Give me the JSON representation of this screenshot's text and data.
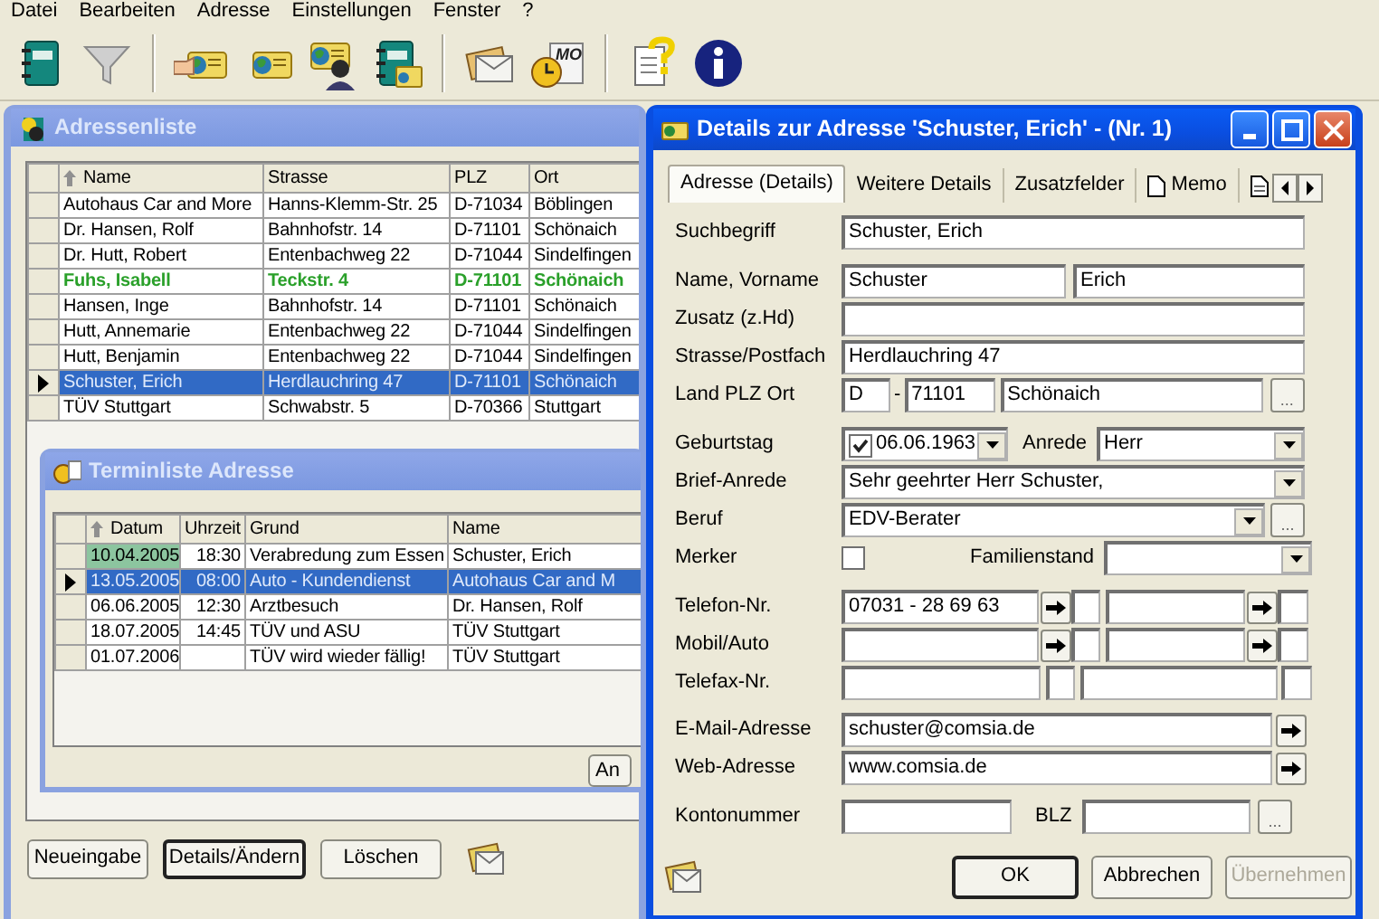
{
  "menu": [
    "Datei",
    "Bearbeiten",
    "Adresse",
    "Einstellungen",
    "Fenster",
    "?"
  ],
  "toolbar": [
    {
      "kind": "notebook"
    },
    {
      "kind": "funnel"
    },
    {
      "kind": "separator"
    },
    {
      "kind": "card-hand"
    },
    {
      "kind": "card-globe"
    },
    {
      "kind": "card-person"
    },
    {
      "kind": "notebook-card"
    },
    {
      "kind": "separator"
    },
    {
      "kind": "letters"
    },
    {
      "kind": "clock-memo",
      "caption": "MO"
    },
    {
      "kind": "separator"
    },
    {
      "kind": "help"
    },
    {
      "kind": "info"
    }
  ],
  "address_window": {
    "title": "Adressenliste",
    "columns": [
      {
        "label": "Name",
        "sorted": true
      },
      {
        "label": "Strasse",
        "sorted": false
      },
      {
        "label": "PLZ",
        "sorted": false
      },
      {
        "label": "Ort",
        "sorted": false
      }
    ],
    "rows": [
      {
        "cells": [
          "Autohaus Car and More",
          "Hanns-Klemm-Str. 25",
          "D-71034",
          "Böblingen"
        ],
        "selected": false,
        "marked": false
      },
      {
        "cells": [
          "Dr. Hansen, Rolf",
          "Bahnhofstr. 14",
          "D-71101",
          "Schönaich"
        ],
        "selected": false,
        "marked": false
      },
      {
        "cells": [
          "Dr. Hutt, Robert",
          "Entenbachweg 22",
          "D-71044",
          "Sindelfingen"
        ],
        "selected": false,
        "marked": false
      },
      {
        "cells": [
          "Fuhs, Isabell",
          "Teckstr. 4",
          "D-71101",
          "Schönaich"
        ],
        "selected": false,
        "marked": true
      },
      {
        "cells": [
          "Hansen, Inge",
          "Bahnhofstr. 14",
          "D-71101",
          "Schönaich"
        ],
        "selected": false,
        "marked": false
      },
      {
        "cells": [
          "Hutt, Annemarie",
          "Entenbachweg 22",
          "D-71044",
          "Sindelfingen"
        ],
        "selected": false,
        "marked": false
      },
      {
        "cells": [
          "Hutt, Benjamin",
          "Entenbachweg 22",
          "D-71044",
          "Sindelfingen"
        ],
        "selected": false,
        "marked": false
      },
      {
        "cells": [
          "Schuster, Erich",
          "Herdlauchring 47",
          "D-71101",
          "Schönaich"
        ],
        "selected": true,
        "marked": false
      },
      {
        "cells": [
          "TÜV Stuttgart",
          "Schwabstr. 5",
          "D-70366",
          "Stuttgart"
        ],
        "selected": false,
        "marked": false
      }
    ],
    "buttons": [
      {
        "label": "Neueingabe",
        "default": false
      },
      {
        "label": "Details/Ändern",
        "default": true
      },
      {
        "label": "Löschen",
        "default": false
      }
    ]
  },
  "appointments_window": {
    "title": "Terminliste Adresse",
    "columns": [
      {
        "label": "Datum",
        "sorted": true
      },
      {
        "label": "Uhrzeit",
        "sorted": false
      },
      {
        "label": "Grund",
        "sorted": false
      },
      {
        "label": "Name",
        "sorted": false
      }
    ],
    "rows": [
      {
        "cells": [
          "10.04.2005",
          "18:30",
          "Verabredung zum Essen",
          "Schuster, Erich"
        ],
        "selected": false,
        "focused": true
      },
      {
        "cells": [
          "13.05.2005",
          "08:00",
          "Auto - Kundendienst",
          "Autohaus Car and M"
        ],
        "selected": true,
        "focused": false
      },
      {
        "cells": [
          "06.06.2005",
          "12:30",
          "Arztbesuch",
          "Dr. Hansen, Rolf"
        ],
        "selected": false,
        "focused": false
      },
      {
        "cells": [
          "18.07.2005",
          "14:45",
          "TÜV und ASU",
          "TÜV Stuttgart"
        ],
        "selected": false,
        "focused": false
      },
      {
        "cells": [
          "01.07.2006",
          null,
          "TÜV wird wieder fällig!",
          "TÜV Stuttgart"
        ],
        "selected": false,
        "focused": false
      }
    ],
    "button": "An"
  },
  "details": {
    "title": "Details zur Adresse 'Schuster, Erich' - (Nr. 1)",
    "tabs": [
      {
        "kind": "text",
        "label": "Adresse (Details)",
        "selected": true
      },
      {
        "kind": "text",
        "label": "Weitere Details",
        "selected": false
      },
      {
        "kind": "text",
        "label": "Zusatzfelder",
        "selected": false
      },
      {
        "kind": "icon-label",
        "label": "Memo",
        "selected": false
      },
      {
        "kind": "icon-only",
        "selected": false
      }
    ],
    "search_term": {
      "label": "Suchbegriff",
      "value": "Schuster, Erich"
    },
    "name": {
      "label": "Name, Vorname",
      "last_name": "Schuster",
      "first_name": "Erich"
    },
    "addition": {
      "label": "Zusatz (z.Hd)"
    },
    "street": {
      "label": "Strasse/Postfach",
      "value": "Herdlauchring 47"
    },
    "location": {
      "label": "Land PLZ Ort",
      "country": "D",
      "separator": "-",
      "zip": "71101",
      "city": "Schönaich",
      "browse": "..."
    },
    "birthday": {
      "label": "Geburtstag",
      "checked": true,
      "value": "06.06.1963"
    },
    "salutation": {
      "label": "Anrede",
      "value": "Herr"
    },
    "letter_salutation": {
      "label": "Brief-Anrede",
      "value": "Sehr geehrter Herr Schuster,"
    },
    "profession": {
      "label": "Beruf",
      "value": "EDV-Berater",
      "browse": "..."
    },
    "marker": {
      "label": "Merker",
      "checked": false
    },
    "marital_status": {
      "label": "Familienstand"
    },
    "phones": [
      {
        "label": "Telefon-Nr.",
        "value": "07031 - 28 69 63",
        "dial": true
      },
      {
        "label": "Mobil/Auto",
        "dial": true
      },
      {
        "label": "Telefax-Nr.",
        "dial": false
      }
    ],
    "email": {
      "label": "E-Mail-Adresse",
      "value": "schuster@comsia.de"
    },
    "web": {
      "label": "Web-Adresse",
      "value": "www.comsia.de"
    },
    "account": {
      "label": "Kontonummer"
    },
    "bank_code": {
      "label": "BLZ",
      "browse": "..."
    },
    "buttons": [
      {
        "label": "OK",
        "default": true,
        "disabled": false
      },
      {
        "label": "Abbrechen",
        "default": false,
        "disabled": false
      },
      {
        "label": "Übernehmen",
        "default": false,
        "disabled": true
      }
    ]
  }
}
